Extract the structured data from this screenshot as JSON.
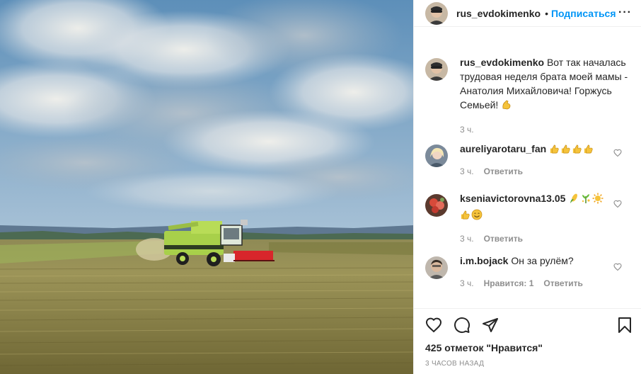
{
  "post": {
    "author": "rus_evdokimenko",
    "header_dot": "•",
    "follow_label": "Подписаться",
    "more_label": "···",
    "likes_text": "425 отметок \"Нравится\"",
    "posted_ago": "3 часов назад"
  },
  "caption": {
    "username": "rus_evdokimenko",
    "text": "Вот так началась трудовая неделя брата моей мамы - Анатолия Михайловича! Горжусь Семьей!",
    "emoji": "flexed-biceps",
    "time": "3 ч."
  },
  "comments": [
    {
      "username": "aureliyarotaru_fan",
      "text": "",
      "emojis": [
        "thumbs-up",
        "thumbs-up",
        "thumbs-up",
        "thumbs-up"
      ],
      "time": "3 ч.",
      "likes_label": "",
      "reply_label": "Ответить"
    },
    {
      "username": "kseniavictorovna13.05",
      "text": "",
      "emojis": [
        "corn",
        "sparkle-plant",
        "sun",
        "thumbs-up",
        "smiling-face"
      ],
      "time": "3 ч.",
      "likes_label": "",
      "reply_label": "Ответить"
    },
    {
      "username": "i.m.bojack",
      "text": "Он за рулём?",
      "emojis": [],
      "time": "3 ч.",
      "likes_label": "Нравится: 1",
      "reply_label": "Ответить"
    }
  ],
  "icons": {
    "like": "heart-icon",
    "comment": "comment-icon",
    "share": "share-icon",
    "save": "bookmark-icon"
  },
  "colors": {
    "link_blue": "#0095f6",
    "secondary_text": "#8e8e8e",
    "border": "#efefef",
    "combine_green": "#a8d04a",
    "header_red": "#d8262b"
  }
}
